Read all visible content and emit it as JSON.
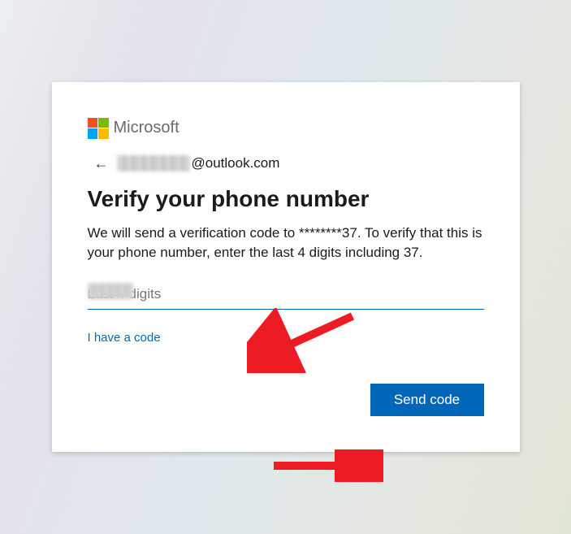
{
  "brand": {
    "name": "Microsoft"
  },
  "identity": {
    "email_hidden_prefix": "",
    "email_suffix": "@outlook.com"
  },
  "title": "Verify your phone number",
  "description": "We will send a verification code to ********37. To verify that this is your phone number, enter the last 4 digits including 37.",
  "input": {
    "placeholder": "Last 4 digits"
  },
  "links": {
    "have_code": "I have a code"
  },
  "buttons": {
    "send": "Send code"
  },
  "colors": {
    "primary": "#0067b8",
    "annotation": "#ed1c24"
  }
}
